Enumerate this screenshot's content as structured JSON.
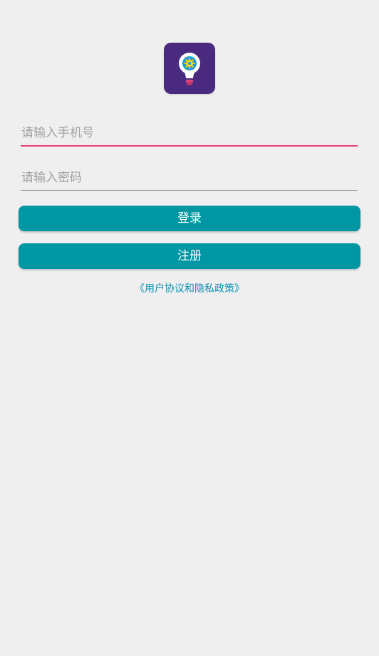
{
  "app": {
    "logo_icon": "lightbulb-gear-icon",
    "colors": {
      "logo_bg": "#4a2a7e",
      "accent": "#e8407a",
      "button": "#0097a4",
      "link": "#0a94b8"
    }
  },
  "login_form": {
    "phone_placeholder": "请输入手机号",
    "phone_value": "",
    "password_placeholder": "请输入密码",
    "password_value": "",
    "login_label": "登录",
    "register_label": "注册",
    "policy_link_text": "《用户协议和隐私政策》"
  }
}
